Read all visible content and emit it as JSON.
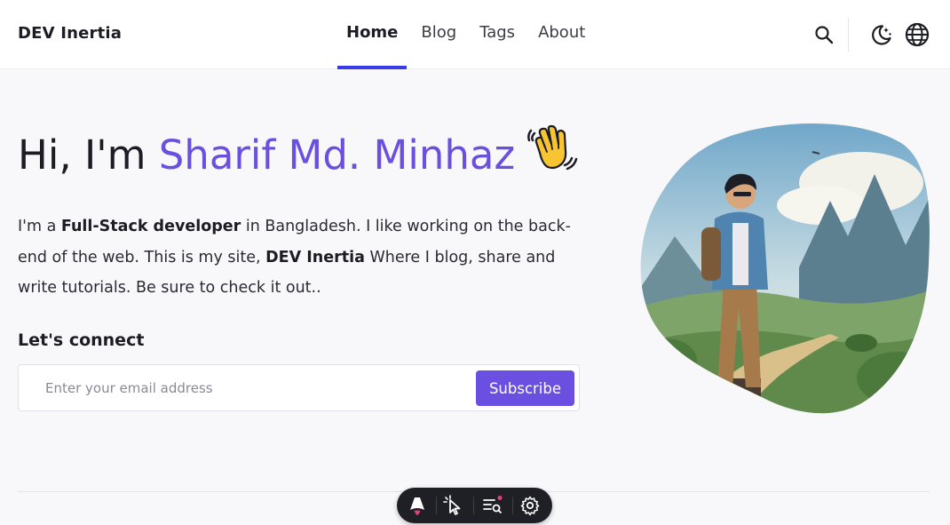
{
  "header": {
    "brand": "DEV Inertia",
    "nav": [
      {
        "label": "Home",
        "active": true
      },
      {
        "label": "Blog",
        "active": false
      },
      {
        "label": "Tags",
        "active": false
      },
      {
        "label": "About",
        "active": false
      }
    ],
    "icons": [
      "search-icon",
      "theme-toggle-icon",
      "language-globe-icon"
    ]
  },
  "hero": {
    "greeting": "Hi, I'm ",
    "name": "Sharif Md. Minhaz",
    "emoji": "waving-hand-icon",
    "intro": {
      "p1": "I'm a ",
      "b1": "Full-Stack developer",
      "p2": " in Bangladesh. I like working on the back-end of the web. This is my site, ",
      "b2": "DEV Inertia",
      "p3": " Where I blog, share and write tutorials. Be sure to check it out.."
    }
  },
  "connect": {
    "title": "Let's connect",
    "email_placeholder": "Enter your email address",
    "email_value": "",
    "button_label": "Subscribe"
  },
  "dev_toolbar": {
    "icons": [
      "astro-logo-icon",
      "cursor-inspect-icon",
      "audit-search-icon",
      "gear-icon"
    ]
  },
  "colors": {
    "accent": "#6a4fe0",
    "nav_indicator": "#3b3be6",
    "background": "#f8f8fa"
  }
}
